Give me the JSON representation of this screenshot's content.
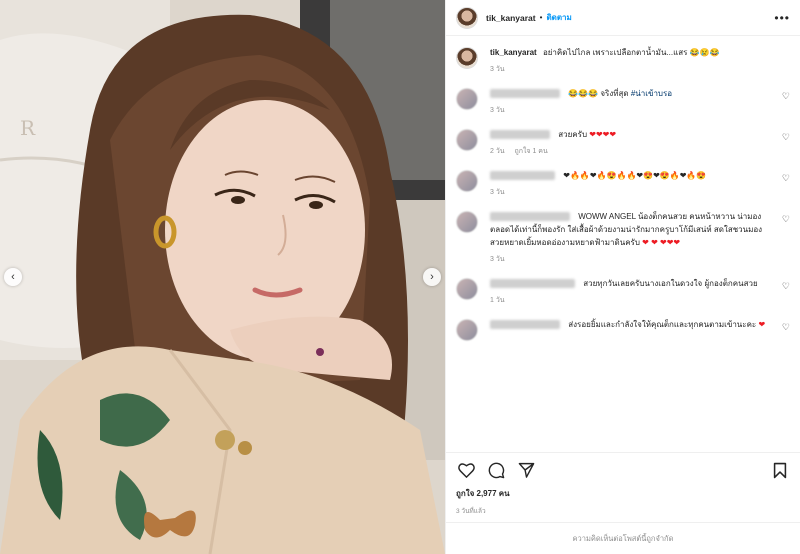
{
  "carousel": {
    "prev_label": "‹",
    "next_label": "›"
  },
  "header": {
    "username": "tik_kanyarat",
    "separator": "•",
    "follow_label": "ติดตาม",
    "more_label": "•••"
  },
  "caption": {
    "username": "tik_kanyarat",
    "text": "อย่าคิดไปไกล เพราะเปลือกตาน้ำมัน...แสร 😂😢😂",
    "time": "3 วัน"
  },
  "comments": [
    {
      "text": "😂😂😂 จริงที่สุด",
      "hashtag": "#น่าเข้าบรอ",
      "meta": [
        "3 วัน"
      ],
      "name_width": 70
    },
    {
      "text": "สวยครับ",
      "hearts": "❤❤❤❤",
      "meta": [
        "2 วัน",
        "ถูกใจ 1 คน"
      ],
      "name_width": 60
    },
    {
      "text": "❤🔥🔥❤🔥😍🔥🔥❤😍❤😍🔥❤🔥😍",
      "meta": [
        "3 วัน"
      ],
      "name_width": 65
    },
    {
      "text": "WOWW ANGEL น้องต็กคนสวย คนหน้าหวาน น่ามองตลอดได้เท่านี้ก็พองรัก ใส่เสื้อผ้าด้วยงามน่ารักมากครูบาโก้มีเสน่ห์ สดใสชวนมอง สวยหยาดเยิ้มหอดอ่องามหยาดฟ้ามาดินครับ",
      "hearts": "❤ ❤ ❤❤❤",
      "meta": [
        "3 วัน"
      ],
      "name_width": 80
    },
    {
      "text": "สวยทุกวันเลยครับนางเอกในดวงใจ ผู้กองต็กคนสวย",
      "meta": [
        "1 วัน"
      ],
      "name_width": 85
    },
    {
      "text": "ส่งรอยยิ้มและกำลังใจให้คุณต็กและทุกคนตามเข้านะคะ",
      "hearts": "❤",
      "meta": [],
      "name_width": 70
    }
  ],
  "actions": {
    "likes": "ถูกใจ 2,977 คน",
    "date": "3 วันที่แล้ว"
  },
  "comments_disabled": "ความคิดเห็นต่อโพสต์นี้ถูกจำกัด",
  "icons": [
    "heart-icon",
    "comment-icon",
    "share-icon",
    "bookmark-icon",
    "chevron-left-icon",
    "chevron-right-icon"
  ],
  "colors": {
    "link": "#0095f6",
    "hashtag": "#00376b",
    "muted": "#8e8e8e",
    "heart": "#ed1c24"
  }
}
